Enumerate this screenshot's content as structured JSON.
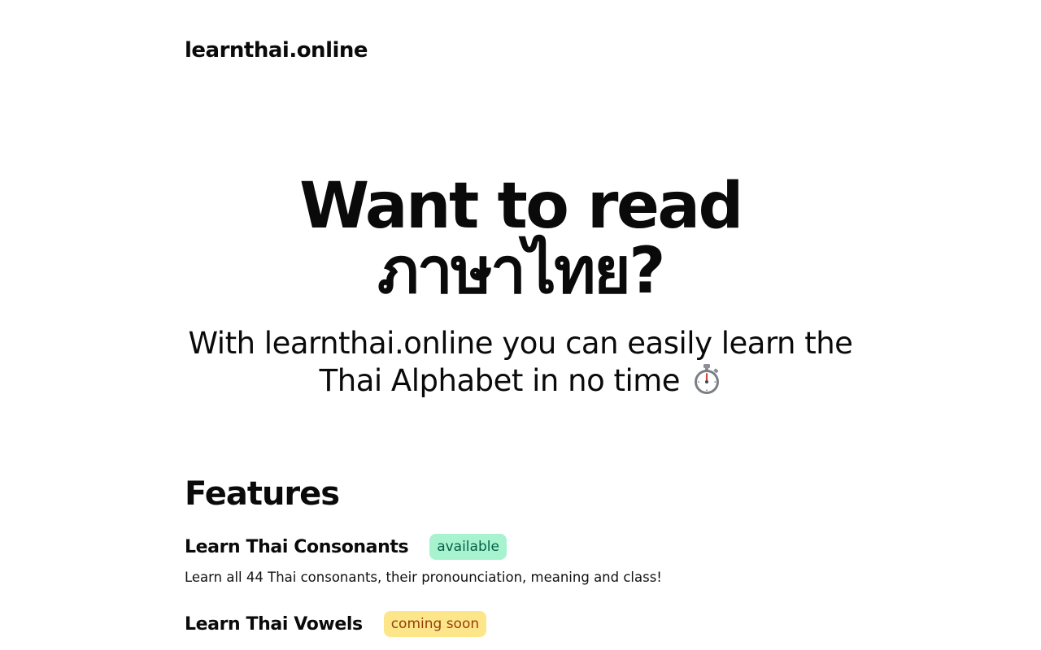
{
  "header": {
    "brand": "learnthai.online"
  },
  "hero": {
    "title": "Want to read ภาษาไทย?",
    "subtitle": "With learnthai.online you can easily learn the Thai Alphabet in no time",
    "subtitle_icon": "stopwatch-icon"
  },
  "features": {
    "heading": "Features",
    "items": [
      {
        "title": "Learn Thai Consonants",
        "badge": "available",
        "badge_color": "#a7f3d0",
        "description": "Learn all 44 Thai consonants, their pronounciation, meaning and class!"
      },
      {
        "title": "Learn Thai Vowels",
        "badge": "coming soon",
        "badge_color": "#fde68a",
        "description": ""
      }
    ]
  }
}
